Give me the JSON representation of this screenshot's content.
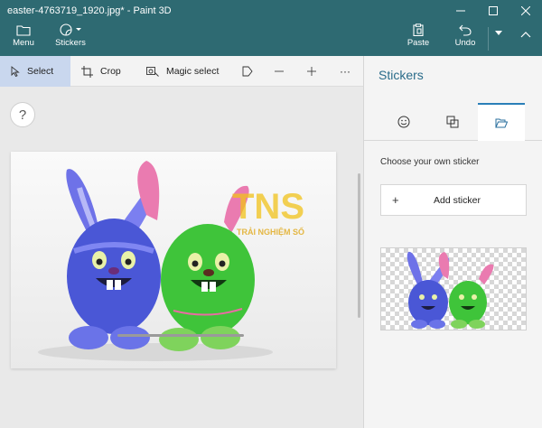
{
  "window": {
    "title": "easter-4763719_1920.jpg* - Paint 3D"
  },
  "ribbon": {
    "menu_label": "Menu",
    "stickers_label": "Stickers",
    "paste_label": "Paste",
    "undo_label": "Undo"
  },
  "toolbar": {
    "select_label": "Select",
    "crop_label": "Crop",
    "magic_select_label": "Magic select",
    "more_label": "···"
  },
  "canvas": {
    "help_label": "?",
    "watermark_main": "TNS",
    "watermark_sub": "TRẢI NGHIỆM SỐ"
  },
  "panel": {
    "title": "Stickers",
    "section_label": "Choose your own sticker",
    "add_sticker_label": "Add sticker",
    "plus_label": "+"
  },
  "colors": {
    "ribbon": "#2e6a72",
    "accent": "#2a7fb8",
    "active_tool": "#c9d7ee",
    "bunny_blue": "#4a57d6",
    "bunny_green": "#3fc43a"
  }
}
